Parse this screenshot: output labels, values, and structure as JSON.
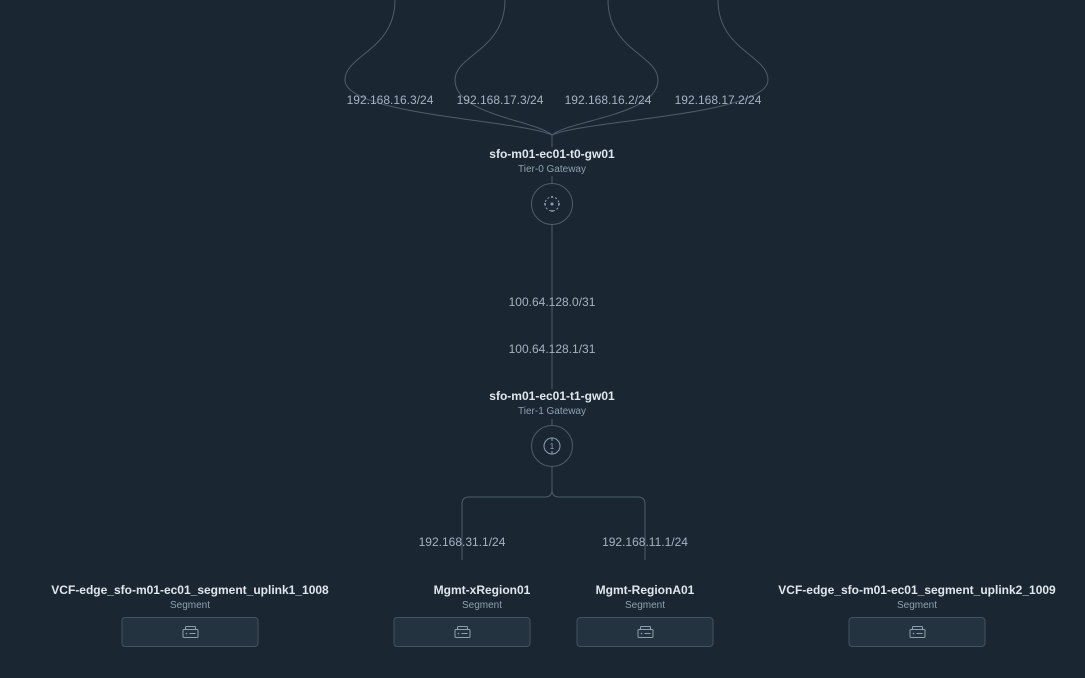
{
  "uplinks": [
    {
      "ip": "192.168.16.3/24"
    },
    {
      "ip": "192.168.17.3/24"
    },
    {
      "ip": "192.168.16.2/24"
    },
    {
      "ip": "192.168.17.2/24"
    }
  ],
  "t0": {
    "name": "sfo-m01-ec01-t0-gw01",
    "type": "Tier-0 Gateway"
  },
  "link_t0_t1": {
    "top_ip": "100.64.128.0/31",
    "bottom_ip": "100.64.128.1/31"
  },
  "t1": {
    "name": "sfo-m01-ec01-t1-gw01",
    "type": "Tier-1 Gateway"
  },
  "t1_child_ips": {
    "left": "192.168.31.1/24",
    "right": "192.168.11.1/24"
  },
  "segments": [
    {
      "name": "VCF-edge_sfo-m01-ec01_segment_uplink1_1008",
      "type": "Segment"
    },
    {
      "name": "Mgmt-xRegion01",
      "type": "Segment"
    },
    {
      "name": "Mgmt-RegionA01",
      "type": "Segment"
    },
    {
      "name": "VCF-edge_sfo-m01-ec01_segment_uplink2_1009",
      "type": "Segment"
    }
  ],
  "colors": {
    "bg": "#1a2733",
    "line": "#4f5d6a",
    "text": "#8ea0ad",
    "title": "#e0e6eb"
  }
}
